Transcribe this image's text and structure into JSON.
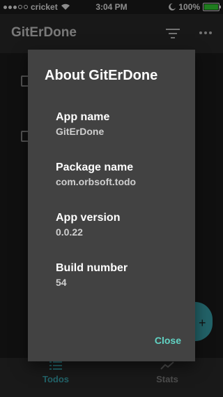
{
  "status": {
    "carrier": "cricket",
    "time": "3:04 PM",
    "battery": "100%",
    "signal_dots": 5,
    "signal_filled": 3
  },
  "app": {
    "title": "GitErDone"
  },
  "dialog": {
    "title": "About GitErDone",
    "fields": [
      {
        "label": "App name",
        "value": "GitErDone"
      },
      {
        "label": "Package name",
        "value": "com.orbsoft.todo"
      },
      {
        "label": "App version",
        "value": "0.0.22"
      },
      {
        "label": "Build number",
        "value": "54"
      }
    ],
    "close_label": "Close"
  },
  "nav": {
    "tabs": [
      {
        "label": "Todos",
        "active": true
      },
      {
        "label": "Stats",
        "active": false
      }
    ]
  },
  "colors": {
    "accent": "#3fb3bd",
    "dialog_bg": "#424242",
    "close_text": "#61d3c4"
  }
}
